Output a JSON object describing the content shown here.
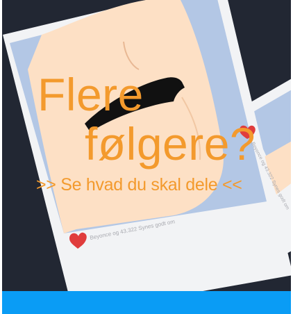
{
  "headline": {
    "line1": "Flere",
    "line2": "følgere?",
    "tagline": ">> Se hvad du skal dele <<"
  },
  "main_post": {
    "likes_text": "Beyonce og 43.322 Synes godt om",
    "heart_icon": "heart-icon"
  },
  "side_post": {
    "likes_text": "Beyonce og 43.322 Synes godt om",
    "heart_icon": "heart-icon"
  },
  "colors": {
    "headline": "#f39a2d",
    "background": "#222733",
    "photo_bg": "#b3c7e5",
    "skin": "#fde0c5",
    "heart": "#e03c3c",
    "bottom_bar": "#0a9cf5"
  }
}
